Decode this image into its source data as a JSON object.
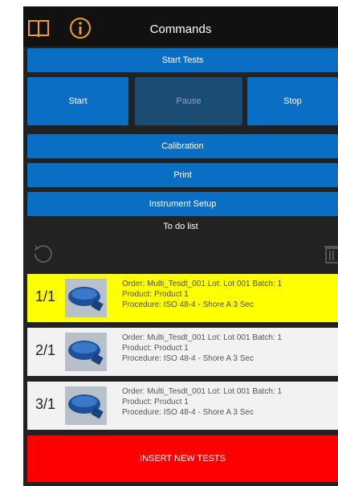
{
  "header": {
    "title": "Commands"
  },
  "buttons": {
    "start_tests": "Start Tests",
    "start": "Start",
    "pause": "Pause",
    "stop": "Stop",
    "calibration": "Calibration",
    "print": "Print",
    "instrument_setup": "Instrument Setup"
  },
  "todo": {
    "label": "To do list"
  },
  "tests": [
    {
      "index": "1/1",
      "order": "Order: Multi_Tesdt_001 Lot: Lot 001 Batch: 1",
      "product": "Product: Product 1",
      "procedure": "Procedure: ISO 48-4 - Shore A 3 Sec"
    },
    {
      "index": "2/1",
      "order": "Order: Multi_Tesdt_001 Lot: Lot 001 Batch: 1",
      "product": "Product: Product 1",
      "procedure": "Procedure: ISO 48-4 - Shore A 3 Sec"
    },
    {
      "index": "3/1",
      "order": "Order: Multi_Tesdt_001 Lot: Lot 001 Batch: 1",
      "product": "Product: Product 1",
      "procedure": "Procedure: ISO 48-4 - Shore A 3 Sec"
    }
  ],
  "insert": {
    "label": "INSERT NEW TESTS"
  },
  "colors": {
    "accent": "#0a6fc4",
    "selected_row": "#ffff00",
    "row": "#f2f2f2",
    "insert": "#ff0000"
  }
}
